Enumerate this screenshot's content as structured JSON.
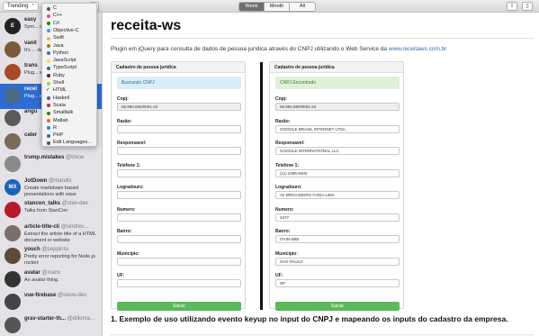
{
  "toolbar": {
    "trending_label": "Trending",
    "segments": [
      "Week",
      "Month",
      "All"
    ],
    "active_segment": "Week"
  },
  "language_menu": {
    "items": [
      {
        "label": "C",
        "color": "#555555"
      },
      {
        "label": "C++",
        "color": "#f34b7d"
      },
      {
        "label": "C#",
        "color": "#178600"
      },
      {
        "label": "Objective-C",
        "color": "#438eff"
      },
      {
        "label": "Swift",
        "color": "#ffac45"
      },
      {
        "label": "Java",
        "color": "#b07219"
      },
      {
        "label": "Python",
        "color": "#3572a5"
      },
      {
        "label": "JavaScript",
        "color": "#f1e05a"
      },
      {
        "label": "TypeScript",
        "color": "#2b7489"
      },
      {
        "label": "Ruby",
        "color": "#701516"
      },
      {
        "label": "Shell",
        "color": "#89e051"
      },
      {
        "label": "HTML",
        "color": "#e34c26",
        "checked": true
      },
      {
        "label": "Haskell",
        "color": "#5e5086"
      },
      {
        "label": "Scala",
        "color": "#c22d40"
      },
      {
        "label": "Smalltalk",
        "color": "#596706"
      },
      {
        "label": "Matlab",
        "color": "#e16737"
      },
      {
        "label": "R",
        "color": "#198ce7"
      },
      {
        "label": "PHP",
        "color": "#4f5d95"
      },
      {
        "label": "Edit Languages...",
        "color": "#555555"
      }
    ]
  },
  "repos": [
    {
      "name": "easy",
      "handle": "",
      "desc": "Sym... docu...",
      "avatar_color": "#222222",
      "avatar_text": "E"
    },
    {
      "name": "vanil",
      "handle": "",
      "desc": "It's ... depe...",
      "avatar_color": "#7a5a3a",
      "avatar_text": ""
    },
    {
      "name": "trans",
      "handle": "",
      "desc": "Plug... web ...",
      "avatar_color": "#a64b2a",
      "avatar_text": ""
    },
    {
      "name": "recei",
      "handle": "",
      "desc": "Plug... dado...",
      "avatar_color": "#4a6a8a",
      "avatar_text": "",
      "selected": true
    },
    {
      "name": "angu",
      "handle": "",
      "desc": "",
      "avatar_color": "#5a5a5a",
      "avatar_text": ""
    },
    {
      "name": "caler",
      "handle": "",
      "desc": "",
      "avatar_color": "#7a6a5a",
      "avatar_text": ""
    },
    {
      "name": "trump.mistakes",
      "handle": "@tmcw",
      "desc": "",
      "avatar_color": "#8a8a8a",
      "avatar_text": ""
    },
    {
      "name": "JotDown",
      "handle": "@mandix",
      "desc": "Create markdown based presentations with ease",
      "avatar_color": "#1d63b8",
      "avatar_text": "MX"
    },
    {
      "name": "stancon_talks",
      "handle": "@stan-dev",
      "desc": "Talks from StanCon",
      "avatar_color": "#b8192c",
      "avatar_text": ""
    },
    {
      "name": "article-title-cli",
      "handle": "@sindres...",
      "desc": "Extract the article title of a HTML document or website",
      "avatar_color": "#7a6f6a",
      "avatar_text": ""
    },
    {
      "name": "youch",
      "handle": "@poppinss",
      "desc": "Pretty error reporting for Node.js rocket:",
      "avatar_color": "#5d4a3a",
      "avatar_text": ""
    },
    {
      "name": "avatar",
      "handle": "@manx",
      "desc": "An avatar thing.",
      "avatar_color": "#333333",
      "avatar_text": ""
    },
    {
      "name": "vue-firebase",
      "handle": "@steve-dev",
      "desc": "",
      "avatar_color": "#444444",
      "avatar_text": ""
    },
    {
      "name": "grav-starter-th...",
      "handle": "@dillonra...",
      "desc": "",
      "avatar_color": "#555555",
      "avatar_text": ""
    }
  ],
  "readme": {
    "title": "receita-ws",
    "description": "Plugin em jQuery para consulta de dados de pessoa jurídica através do CNPJ utilizando o Web Service da",
    "link": "www.receitaws.com.br",
    "section_heading": "1. Exemplo de uso utilizando evento keyup no input do CNPJ e mapeando os inputs do cadastro da empresa.",
    "left_form": {
      "header": "Cadastro de pessoa jurídica",
      "alert": "Buscando CNPJ",
      "alert_color": "#d9edf7",
      "fields": [
        {
          "label": "Cnpj:",
          "value": "06.990.590/0001-23",
          "readonly": true
        },
        {
          "label": "Razão:",
          "value": ""
        },
        {
          "label": "Responsavel:",
          "value": ""
        },
        {
          "label": "Telefone 1:",
          "value": ""
        },
        {
          "label": "Logradouro:",
          "value": ""
        },
        {
          "label": "Numero:",
          "value": ""
        },
        {
          "label": "Bairro:",
          "value": ""
        },
        {
          "label": "Município:",
          "value": ""
        },
        {
          "label": "UF:",
          "value": ""
        }
      ],
      "button": "Salvar"
    },
    "right_form": {
      "header": "Cadastro de pessoa jurídica",
      "alert": "CNPJ Encontrado",
      "alert_color": "#dff0d8",
      "fields": [
        {
          "label": "Cnpj:",
          "value": "06.990.590/0001-23",
          "readonly": true
        },
        {
          "label": "Razão:",
          "value": "GOOGLE BRASIL INTERNET LTDA."
        },
        {
          "label": "Responsavel:",
          "value": "GOOGLE INTERNATIONAL LLC"
        },
        {
          "label": "Telefone 1:",
          "value": "(11) 2395-8400"
        },
        {
          "label": "Logradouro:",
          "value": "AV BRIGADEIRO FARIA LIMA"
        },
        {
          "label": "Numero:",
          "value": "3477"
        },
        {
          "label": "Bairro:",
          "value": "ITAIM BIBI"
        },
        {
          "label": "Município:",
          "value": "SAO PAULO"
        },
        {
          "label": "UF:",
          "value": "SP"
        }
      ],
      "button": "Salvar"
    }
  }
}
